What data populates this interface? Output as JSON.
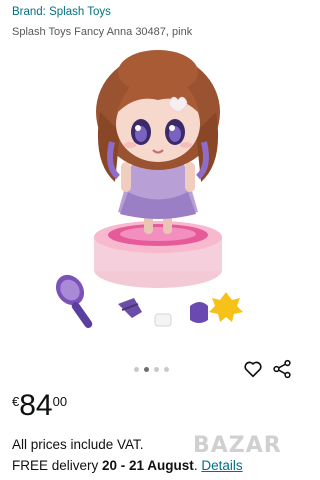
{
  "header": {
    "brand_link": "Brand: Splash Toys",
    "product_title": "Splash Toys Fancy Anna 30487, pink"
  },
  "gallery": {
    "image_icon": "doll-product-photo",
    "dots_count_visible": 4,
    "active_dot_index": 1
  },
  "actions": {
    "heart_icon": "heart-icon",
    "share_icon": "share-icon"
  },
  "price": {
    "currency": "€",
    "whole": "84",
    "fraction": "00"
  },
  "info": {
    "vat_text": "All prices include VAT.",
    "delivery_prefix": "FREE delivery ",
    "delivery_dates": "20 - 21 August",
    "delivery_suffix": ". ",
    "details_link": "Details"
  },
  "watermark": {
    "text": "BAZAR"
  },
  "colors": {
    "link": "#007185",
    "text": "#0f1111"
  }
}
